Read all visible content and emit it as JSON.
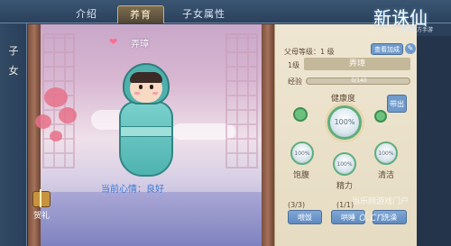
{
  "tabs": {
    "intro": "介绍",
    "raise": "养育",
    "child_attr": "子女属性"
  },
  "sidebar": {
    "label": "子女"
  },
  "child": {
    "name": "弄璋",
    "mood_text": "当前心情：良好"
  },
  "gift": {
    "label": "贺礼"
  },
  "info": {
    "parent_level": "父母等级：1 级",
    "inspect_button": "查看加成",
    "level": "1级",
    "name": "弄璋",
    "exp_label": "经验",
    "exp_value": "0/140",
    "exp_fraction": 0
  },
  "stats": {
    "health": {
      "label": "健康度",
      "value": "100%"
    },
    "satiety": {
      "label": "饱腹",
      "value": "100%"
    },
    "energy": {
      "label": "精力",
      "value": "100%"
    },
    "clean": {
      "label": "清洁",
      "value": "100%"
    },
    "out_button": "带出"
  },
  "actions": {
    "feed_count": "(3/3)",
    "hug_count": "(1/1)",
    "feed": "喂饭",
    "hug": "哄睡",
    "wash": "洗澡"
  },
  "branding": {
    "logo": "新诛仙",
    "logo_sub": "游戏官方手游",
    "site": "当乐网游戏门户",
    "url": "d.cn"
  },
  "colors": {
    "accent": "#6f9acb",
    "panel": "#efe6d2",
    "status_green": "#6bc27d",
    "mood_text": "#3c78d7"
  }
}
